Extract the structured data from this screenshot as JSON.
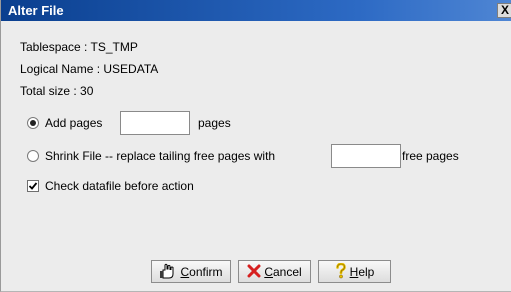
{
  "dialog": {
    "title": "Alter File",
    "close_glyph": "X"
  },
  "info": {
    "tablespace": "Tablespace : TS_TMP",
    "logical_name": "Logical Name : USEDATA",
    "total_size": "Total size : 30"
  },
  "options": {
    "add_pages": {
      "label": "Add pages",
      "suffix": "pages",
      "value": "",
      "selected": true
    },
    "shrink_file": {
      "label": "Shrink File -- replace tailing free pages with",
      "suffix": "free pages",
      "value": "",
      "selected": false
    }
  },
  "check_datafile": {
    "label": "Check datafile before action",
    "checked": true
  },
  "buttons": {
    "confirm": {
      "mnemonic": "C",
      "rest": "onfirm",
      "icon": "hand-icon"
    },
    "cancel": {
      "mnemonic": "C",
      "rest": "ancel",
      "icon": "red-x-icon"
    },
    "help": {
      "mnemonic": "H",
      "rest": "elp",
      "icon": "question-icon"
    }
  },
  "colors": {
    "title_bar": "#1f5cb0",
    "dialog_bg": "#ececec",
    "cancel_icon": "#d61f1f",
    "help_icon": "#e8c000"
  }
}
